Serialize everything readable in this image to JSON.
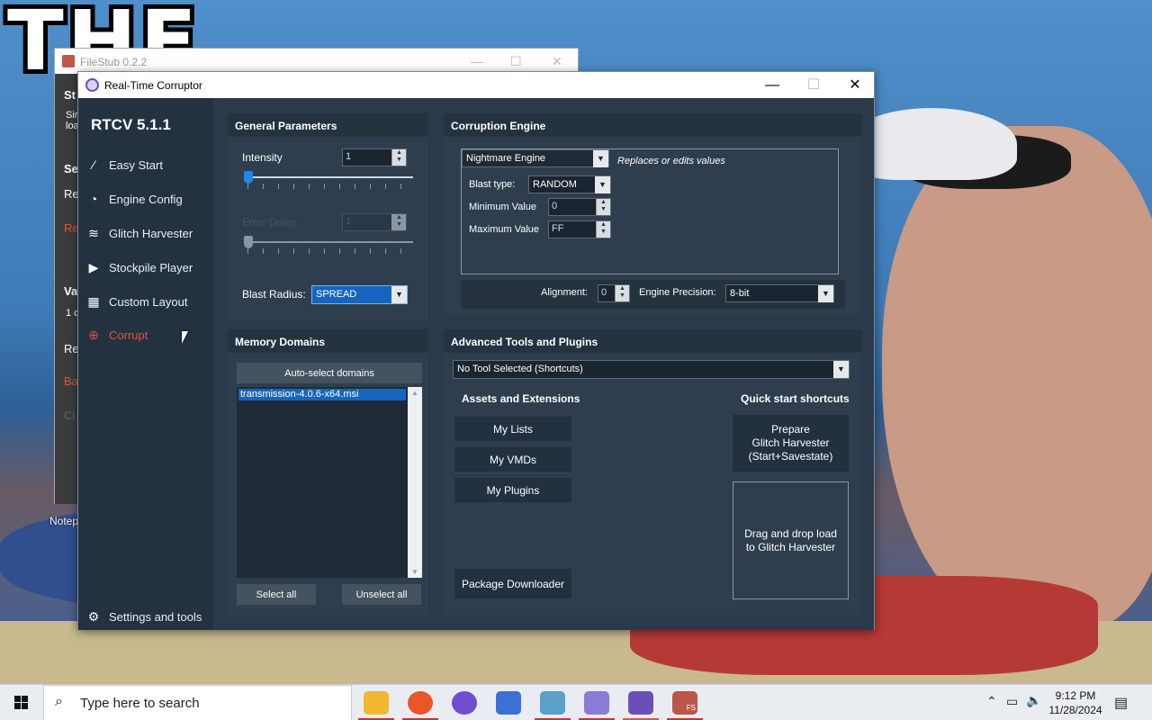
{
  "desktop": {
    "overlay_text": "THE",
    "notepad_label": "Notep"
  },
  "back_window": {
    "title": "FileStub 0.2.2",
    "fragments": [
      "St",
      "Sir",
      "loa",
      "Se",
      "Re",
      "Re",
      "Va",
      "1 c",
      "Re",
      "Ba",
      "Cl"
    ]
  },
  "window": {
    "title": "Real-Time Corruptor",
    "minimize": "—",
    "maximize": "☐",
    "close": "✕"
  },
  "sidebar": {
    "brand": "RTCV 5.1.1",
    "items": [
      {
        "label": "Easy Start",
        "icon": "wand-icon"
      },
      {
        "label": "Engine Config",
        "icon": "gauge-icon"
      },
      {
        "label": "Glitch Harvester",
        "icon": "layers-icon"
      },
      {
        "label": "Stockpile Player",
        "icon": "play-icon"
      },
      {
        "label": "Custom Layout",
        "icon": "grid-icon"
      },
      {
        "label": "Corrupt",
        "icon": "crosshair-icon"
      }
    ],
    "settings": "Settings and tools"
  },
  "general": {
    "title": "General Parameters",
    "intensity_label": "Intensity",
    "intensity_value": "1",
    "error_delay_label": "Error Delay",
    "error_delay_value": "1",
    "blast_radius_label": "Blast Radius:",
    "blast_radius_value": "SPREAD"
  },
  "engine": {
    "title": "Corruption Engine",
    "engine_value": "Nightmare Engine",
    "engine_desc": "Replaces or edits values",
    "blast_type_label": "Blast type:",
    "blast_type_value": "RANDOM",
    "min_label": "Minimum Value",
    "min_value": "0",
    "max_label": "Maximum Value",
    "max_value": "FF",
    "alignment_label": "Alignment:",
    "alignment_value": "0",
    "precision_label": "Engine Precision:",
    "precision_value": "8-bit"
  },
  "memory": {
    "title": "Memory Domains",
    "auto_select": "Auto-select domains",
    "items": [
      "transmission-4.0.6-x64.msi"
    ],
    "select_all": "Select all",
    "unselect_all": "Unselect all"
  },
  "advanced": {
    "title": "Advanced Tools and Plugins",
    "tool_value": "No Tool Selected (Shortcuts)",
    "assets_title": "Assets and Extensions",
    "my_lists": "My Lists",
    "my_vmds": "My VMDs",
    "my_plugins": "My Plugins",
    "package_downloader": "Package Downloader",
    "quick_title": "Quick start shortcuts",
    "prepare_l1": "Prepare",
    "prepare_l2": "Glitch Harvester",
    "prepare_l3": "(Start+Savestate)",
    "drop_l1": "Drag and drop load",
    "drop_l2": "to Glitch Harvester"
  },
  "taskbar": {
    "search_placeholder": "Type here to search",
    "time": "9:12 PM",
    "date": "11/28/2024",
    "apps": [
      {
        "name": "file-explorer-icon",
        "color": "#f2b632"
      },
      {
        "name": "firefox-icon",
        "color": "#e8562a"
      },
      {
        "name": "app-purple-icon",
        "color": "#6f4fd0"
      },
      {
        "name": "game-controller-icon",
        "color": "#3d6fd6"
      },
      {
        "name": "notepad-icon",
        "color": "#5aa0c8"
      },
      {
        "name": "glasses-icon",
        "color": "#8b7ad8"
      },
      {
        "name": "rtcv-icon",
        "color": "#6b4fb8"
      },
      {
        "name": "filestub-icon",
        "color": "#b9574a"
      }
    ],
    "fs_badge": "FS"
  }
}
